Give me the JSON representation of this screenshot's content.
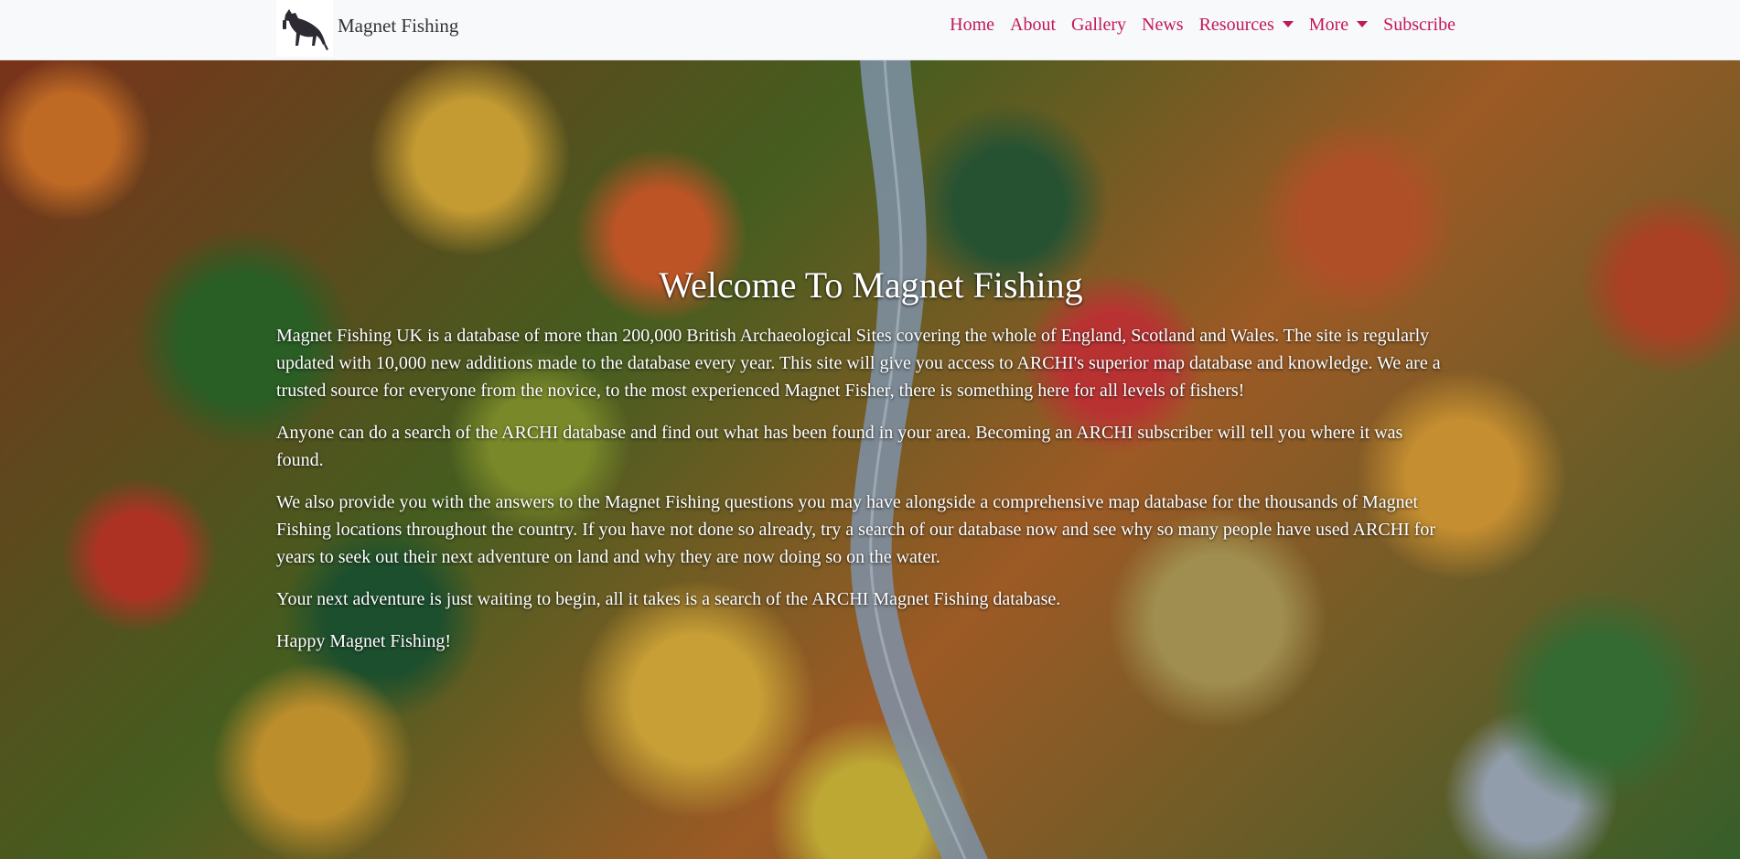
{
  "brand": {
    "name": "Magnet Fishing",
    "logo_icon": "dog-with-magnet-icon"
  },
  "nav": {
    "items": [
      {
        "label": "Home"
      },
      {
        "label": "About"
      },
      {
        "label": "Gallery"
      },
      {
        "label": "News"
      },
      {
        "label": "Resources",
        "dropdown": true
      },
      {
        "label": "More",
        "dropdown": true
      },
      {
        "label": "Subscribe"
      }
    ],
    "link_color": "#c2185b"
  },
  "hero": {
    "title": "Welcome To Magnet Fishing",
    "paragraphs": [
      "Magnet Fishing UK is a database of more than 200,000 British Archaeological Sites covering the whole of England, Scotland and Wales. The site is regularly updated with 10,000 new additions made to the database every year. This site will give you access to ARCHI's superior map database and knowledge. We are a trusted source for everyone from the novice, to the most experienced Magnet Fisher, there is something here for all levels of fishers!",
      "Anyone can do a search of the ARCHI database and find out what has been found in your area. Becoming an ARCHI subscriber will tell you where it was found.",
      "We also provide you with the answers to the Magnet Fishing questions you may have alongside a comprehensive map database for the thousands of Magnet Fishing locations throughout the country. If you have not done so already, try a search of our database now and see why so many people have used ARCHI for years to seek out their next adventure on land and why they are now doing so on the water.",
      "Your next adventure is just waiting to begin, all it takes is a search of the ARCHI Magnet Fishing database.",
      "Happy Magnet Fishing!"
    ]
  }
}
